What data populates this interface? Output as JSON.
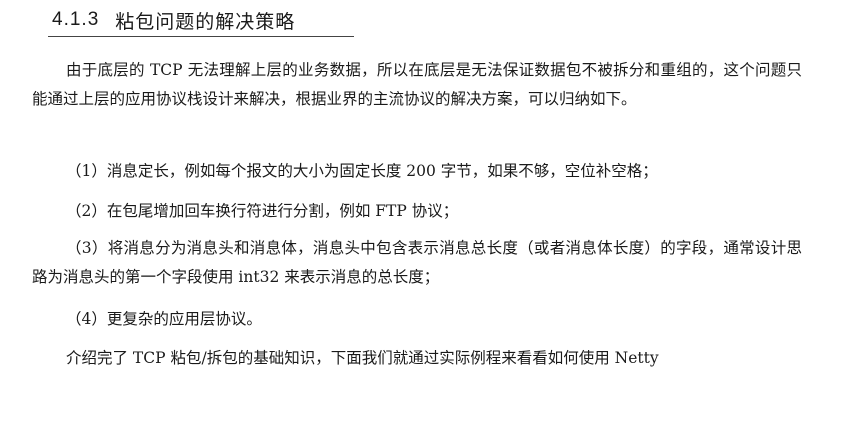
{
  "section": {
    "number": "4.1.3",
    "title": "粘包问题的解决策略"
  },
  "paragraphs": [
    "由于底层的 TCP 无法理解上层的业务数据，所以在底层是无法保证数据包不被拆分和重组的，这个问题只能通过上层的应用协议栈设计来解决，根据业界的主流协议的解决方案，可以归纳如下。",
    "（1）消息定长，例如每个报文的大小为固定长度 200 字节，如果不够，空位补空格；",
    "（2）在包尾增加回车换行符进行分割，例如 FTP 协议；",
    "（3）将消息分为消息头和消息体，消息头中包含表示消息总长度（或者消息体长度）的字段，通常设计思路为消息头的第一个字段使用 int32 来表示消息的总长度；",
    "（4）更复杂的应用层协议。",
    "介绍完了 TCP 粘包/拆包的基础知识，下面我们就通过实际例程来看看如何使用 Netty"
  ]
}
